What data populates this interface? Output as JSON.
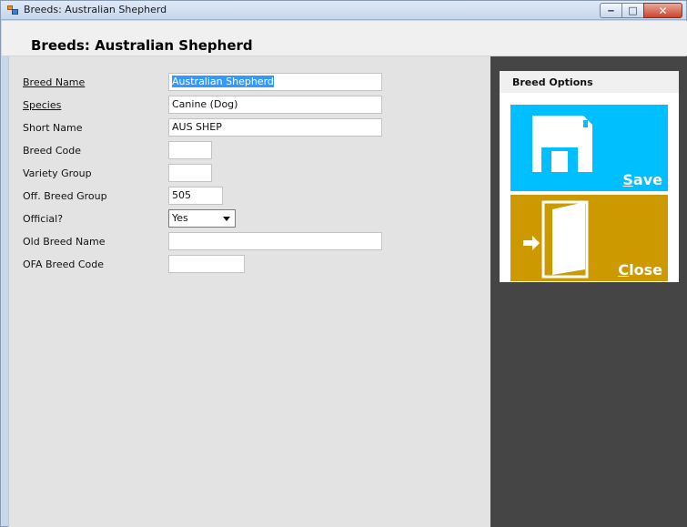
{
  "window": {
    "title": "Breeds: Australian Shepherd"
  },
  "header": {
    "title": "Breeds: Australian Shepherd"
  },
  "form": {
    "breed_name": {
      "label": "Breed Name",
      "value": "Australian Shepherd"
    },
    "species": {
      "label": "Species",
      "value": "Canine (Dog)"
    },
    "short_name": {
      "label": "Short Name",
      "value": "AUS SHEP"
    },
    "breed_code": {
      "label": "Breed Code",
      "value": ""
    },
    "variety_group": {
      "label": "Variety Group",
      "value": ""
    },
    "off_breed_group": {
      "label": "Off. Breed Group",
      "value": "505"
    },
    "official": {
      "label": "Official?",
      "value": "Yes"
    },
    "old_breed_name": {
      "label": "Old Breed Name",
      "value": ""
    },
    "ofa_breed_code": {
      "label": "OFA Breed Code",
      "value": ""
    }
  },
  "options": {
    "title": "Breed Options",
    "save": {
      "accel": "S",
      "rest": "ave",
      "icon": "floppy-disk-icon",
      "color": "#00bfff"
    },
    "close": {
      "accel": "C",
      "rest": "lose",
      "icon": "exit-door-icon",
      "color": "#cc9900"
    }
  },
  "colors": {
    "panel_dark": "#454545",
    "client_bg": "#e3e3e3",
    "selection": "#3399ff"
  }
}
